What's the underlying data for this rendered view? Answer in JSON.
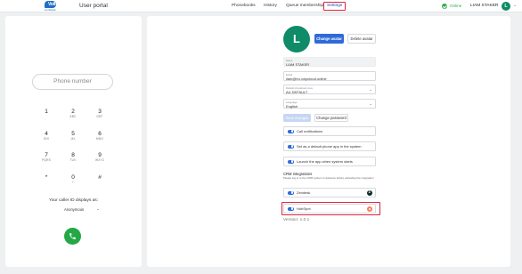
{
  "header": {
    "logo_word": "VoIP",
    "logo_tagline": "workdesk",
    "title": "User portal",
    "nav": [
      "Phonebooks",
      "History",
      "Queue membership",
      "Settings"
    ],
    "active_nav": "Settings",
    "status": "Online",
    "user_name": "LIAM STAKER",
    "avatar_initial": "L"
  },
  "dialer": {
    "phone_placeholder": "Phone number",
    "keys": [
      {
        "digit": "1",
        "letters": ""
      },
      {
        "digit": "2",
        "letters": "ABC"
      },
      {
        "digit": "3",
        "letters": "DEF"
      },
      {
        "digit": "4",
        "letters": "GHI"
      },
      {
        "digit": "5",
        "letters": "JKL"
      },
      {
        "digit": "6",
        "letters": "MNO"
      },
      {
        "digit": "7",
        "letters": "PQRS"
      },
      {
        "digit": "8",
        "letters": "TUV"
      },
      {
        "digit": "9",
        "letters": "WXYZ"
      },
      {
        "digit": "*",
        "letters": ""
      },
      {
        "digit": "0",
        "letters": "+"
      },
      {
        "digit": "#",
        "letters": ""
      }
    ],
    "caller_id_label": "Your caller ID displays as:",
    "caller_id_value": "Anonymous"
  },
  "settings": {
    "avatar_initial": "L",
    "change_avatar": "Change avatar",
    "delete_avatar": "Delete avatar",
    "name_label": "Name",
    "name_value": "LIAM STAKER",
    "email_label": "Email",
    "email_value": "liam@eu.voipcloud.online",
    "phonebook_label": "Default phonebook view",
    "phonebook_value": "AU DEFAULT",
    "language_label": "Language",
    "language_value": "English",
    "save_changes": "Save changes",
    "change_password": "Change password",
    "toggles": [
      "Call notifications",
      "Set as a default phone app in the system",
      "Launch the app when system starts"
    ],
    "crm_title": "CRM integrations",
    "crm_hint": "Please log in to the CRM system in advance before activating the integration",
    "crm_items": [
      "Zendesk",
      "HubSpot"
    ],
    "version": "Version: 1.0.1"
  },
  "colors": {
    "accent": "#2f6ad8",
    "online": "#2eaa4f",
    "avatar": "#0f8b67",
    "highlight": "#e0243e",
    "call": "#24a846"
  }
}
